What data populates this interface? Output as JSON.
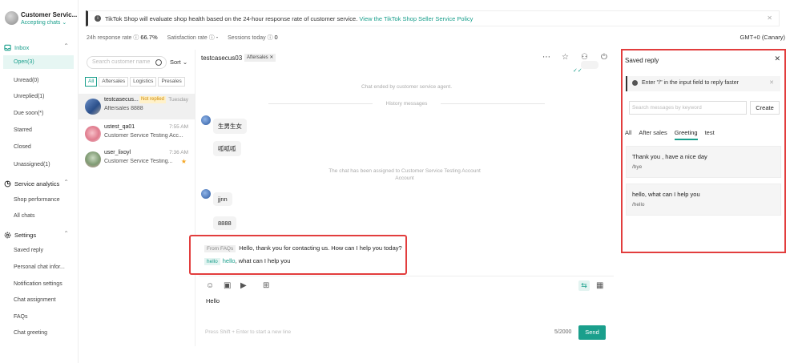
{
  "sidebar": {
    "shop_name": "Customer Servic...",
    "status": "Accepting chats",
    "inbox_label": "Inbox",
    "inbox_items": [
      "Open(3)",
      "Unread(0)",
      "Unreplied(1)",
      "Due soon(*)",
      "Starred",
      "Closed",
      "Unassigned(1)"
    ],
    "analytics_label": "Service analytics",
    "analytics_items": [
      "Shop performance",
      "All chats"
    ],
    "settings_label": "Settings",
    "settings_items": [
      "Saved reply",
      "Personal chat infor...",
      "Notification settings",
      "Chat assignment",
      "FAQs",
      "Chat greeting"
    ]
  },
  "banner": {
    "text": "TikTok Shop will evaluate shop health based on the 24-hour response rate of customer service.",
    "link": "View the TikTok Shop Seller Service Policy"
  },
  "metrics": {
    "response_label": "24h response rate",
    "response_value": "66.7%",
    "satisfaction_label": "Satisfaction rate",
    "satisfaction_value": "-",
    "sessions_label": "Sessions today",
    "sessions_value": "0",
    "timezone": "GMT+0 (Canary)"
  },
  "list": {
    "search_placeholder": "Search customer name",
    "sort_label": "Sort",
    "filters": [
      "All",
      "Aftersales",
      "Logistics",
      "Presales"
    ],
    "conversations": [
      {
        "name": "testcasecus...",
        "tag": "Not replied",
        "time": "Tuesday",
        "preview": "Aftersales 8888"
      },
      {
        "name": "ustest_qa01",
        "tag": "",
        "time": "7:55 AM",
        "preview": "Customer Service Testing Acc..."
      },
      {
        "name": "user_lixoyl",
        "tag": "",
        "time": "7:36 AM",
        "preview": "Customer Service Testing..."
      }
    ]
  },
  "chat": {
    "customer": "testcasecus03",
    "tag": "Aftersales",
    "system_ended": "Chat ended by customer service agent.",
    "history_label": "History messages",
    "msg1": "生男生女",
    "msg2": "呱呱呱",
    "system_assigned": "The chat has been assigned to Customer Service Testing Account Account",
    "msg3": "jjnn",
    "msg4": "8888",
    "faq_badge": "From FAQs",
    "faq_text": "Hello, thank you for contacting us. How can I help you today?",
    "quick_keyword": "hello",
    "quick_highlight": "hello",
    "quick_rest": ", what can I help you",
    "draft": "Hello",
    "input_hint": "Press Shift + Enter to start a new line",
    "char_count": "5/2000",
    "send_label": "Send"
  },
  "saved_reply": {
    "title": "Saved reply",
    "tip": "Enter \"/\" in the input field to reply faster",
    "search_placeholder": "Search messages by keyword",
    "create_label": "Create",
    "tabs": [
      "All",
      "After sales",
      "Greeting",
      "test"
    ],
    "cards": [
      {
        "text": "Thank you , have a nice day",
        "shortcut": "/bye"
      },
      {
        "text": "hello, what can I help you",
        "shortcut": "/hello"
      }
    ]
  },
  "colors": {
    "accent": "#1a9f8c",
    "highlight_border": "#e23d3d",
    "not_replied_bg": "#fff1c9"
  }
}
